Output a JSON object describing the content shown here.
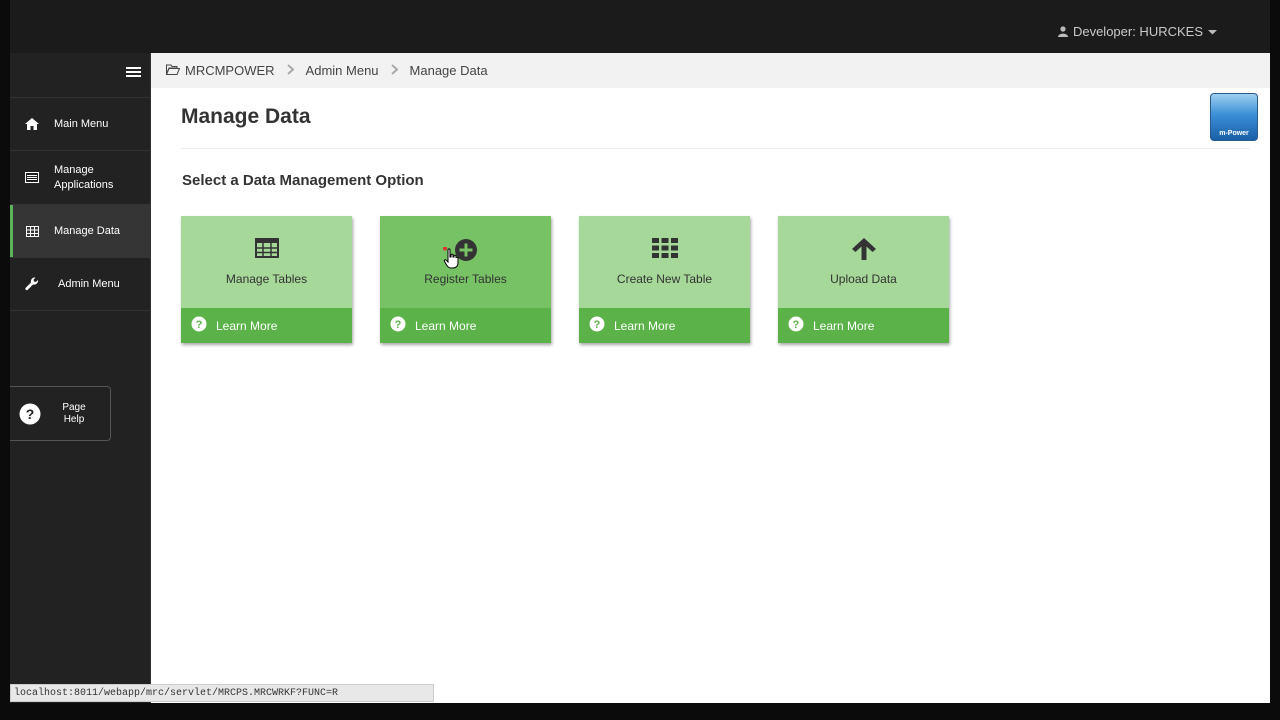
{
  "header": {
    "user_label": "Developer: HURCKES"
  },
  "sidebar": {
    "items": [
      {
        "label": "Main Menu",
        "icon": "home-icon"
      },
      {
        "label": "Manage Applications",
        "icon": "list-icon"
      },
      {
        "label": "Manage Data",
        "icon": "table-icon",
        "active": true
      },
      {
        "label": "Admin Menu",
        "icon": "wrench-icon"
      }
    ],
    "help": {
      "line1": "Page",
      "line2": "Help"
    }
  },
  "breadcrumb": {
    "root": "MRCMPOWER",
    "level1": "Admin Menu",
    "level2": "Manage Data"
  },
  "main": {
    "title": "Manage Data",
    "subtitle": "Select a Data Management Option",
    "logo_text": "m-Power"
  },
  "cards": [
    {
      "label": "Manage Tables",
      "icon": "table-icon",
      "learn": "Learn More"
    },
    {
      "label": "Register Tables",
      "icon": "plus-circle-icon",
      "learn": "Learn More",
      "hover": true
    },
    {
      "label": "Create New Table",
      "icon": "grid-icon",
      "learn": "Learn More"
    },
    {
      "label": "Upload Data",
      "icon": "arrow-up-icon",
      "learn": "Learn More"
    }
  ],
  "status_bar": {
    "url": "localhost:8011/webapp/mrc/servlet/MRCPS.MRCWRKF?FUNC=R"
  },
  "colors": {
    "card_top": "#a6d89a",
    "card_top_hover": "#76c265",
    "card_bottom": "#5ab248",
    "sidebar_bg": "#222222",
    "topbar_bg": "#1b1b1b"
  }
}
